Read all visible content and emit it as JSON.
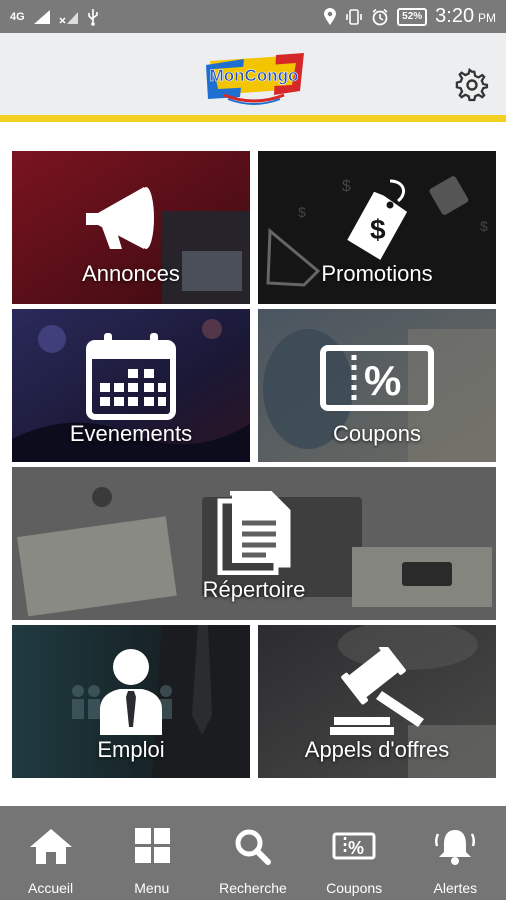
{
  "status_bar": {
    "network": "4G",
    "battery": "52%",
    "time": "3:20",
    "ampm": "PM"
  },
  "header": {
    "logo_text": "MonCongo"
  },
  "tiles": [
    {
      "label": "Annonces",
      "icon": "megaphone-icon"
    },
    {
      "label": "Promotions",
      "icon": "price-tag-icon"
    },
    {
      "label": "Evenements",
      "icon": "calendar-icon"
    },
    {
      "label": "Coupons",
      "icon": "coupon-icon"
    },
    {
      "label": "Répertoire",
      "icon": "document-icon"
    },
    {
      "label": "Emploi",
      "icon": "businessman-icon"
    },
    {
      "label": "Appels d'offres",
      "icon": "gavel-icon"
    }
  ],
  "bottom_nav": [
    {
      "label": "Accueil",
      "icon": "home-icon"
    },
    {
      "label": "Menu",
      "icon": "grid-icon"
    },
    {
      "label": "Recherche",
      "icon": "search-icon"
    },
    {
      "label": "Coupons",
      "icon": "coupon-icon"
    },
    {
      "label": "Alertes",
      "icon": "bell-icon"
    }
  ],
  "colors": {
    "header_accent": "#f3cf1f",
    "nav_bg": "#757575",
    "status_bg": "#7a7a7a"
  }
}
